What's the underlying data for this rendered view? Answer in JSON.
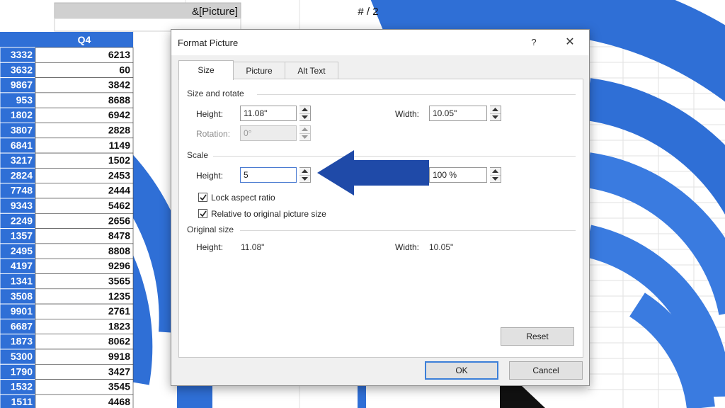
{
  "spreadsheet": {
    "header_cell": "&[Picture]",
    "page_number": "# / 2",
    "column_q4_header": "Q4",
    "left_column": [
      "3332",
      "3632",
      "9867",
      "953",
      "1802",
      "3807",
      "6841",
      "3217",
      "2824",
      "7748",
      "9343",
      "2249",
      "1357",
      "2495",
      "4197",
      "1341",
      "3508",
      "9901",
      "6687",
      "1873",
      "5300",
      "1790",
      "1532",
      "1511"
    ],
    "q4_column": [
      "6213",
      "60",
      "3842",
      "8688",
      "6942",
      "2828",
      "1149",
      "1502",
      "2453",
      "2444",
      "5462",
      "2656",
      "8478",
      "8808",
      "9296",
      "3565",
      "1235",
      "2761",
      "1823",
      "8062",
      "9918",
      "3427",
      "3545",
      "4468"
    ]
  },
  "dialog": {
    "title": "Format Picture",
    "help_label": "?",
    "close_label": "✕",
    "tabs": [
      {
        "label": "Size",
        "active": true
      },
      {
        "label": "Picture",
        "active": false
      },
      {
        "label": "Alt Text",
        "active": false
      }
    ],
    "size_rotate": {
      "section_label": "Size and rotate",
      "height_label": "Height:",
      "height_value": "11.08\"",
      "width_label": "Width:",
      "width_value": "10.05\"",
      "rotation_label": "Rotation:",
      "rotation_value": "0°"
    },
    "scale": {
      "section_label": "Scale",
      "height_label": "Height:",
      "height_value": "5",
      "width_value": "100 %",
      "lock_aspect_label": "Lock aspect ratio",
      "lock_aspect_checked": true,
      "relative_label": "Relative to original picture size",
      "relative_checked": true
    },
    "original_size": {
      "section_label": "Original size",
      "height_label": "Height:",
      "height_value": "11.08\"",
      "width_label": "Width:",
      "width_value": "10.05\""
    },
    "buttons": {
      "reset": "Reset",
      "ok": "OK",
      "cancel": "Cancel"
    }
  },
  "colors": {
    "accent_blue": "#2f6fd6",
    "dark_blue": "#1e4fb3",
    "arrow_blue": "#1f4aa8"
  }
}
